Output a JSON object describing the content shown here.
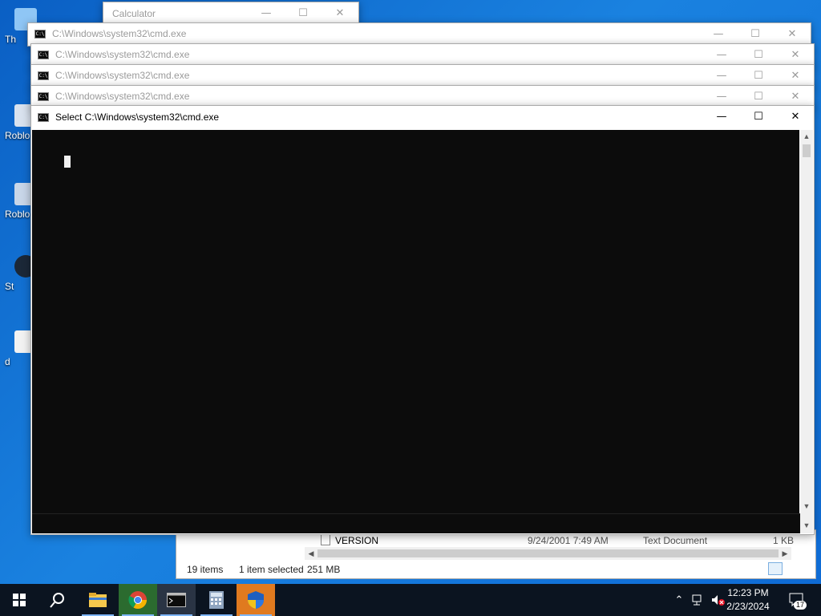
{
  "desktop": {
    "icons": [
      {
        "label": "Th",
        "name": "this-pc"
      },
      {
        "label": "Roblo",
        "name": "roblox-player"
      },
      {
        "label": "Roblo",
        "name": "roblox-studio"
      },
      {
        "label": "St",
        "name": "steam"
      },
      {
        "label": "d",
        "name": "document"
      }
    ]
  },
  "calculator": {
    "title": "Calculator"
  },
  "cmd_windows": [
    {
      "title": "C:\\Windows\\system32\\cmd.exe"
    },
    {
      "title": "C:\\Windows\\system32\\cmd.exe"
    },
    {
      "title": "C:\\Windows\\system32\\cmd.exe"
    },
    {
      "title": "C:\\Windows\\system32\\cmd.exe"
    }
  ],
  "active_cmd": {
    "title": "Select C:\\Windows\\system32\\cmd.exe"
  },
  "window_controls": {
    "minimize": "—",
    "maximize": "☐",
    "close": "✕"
  },
  "explorer": {
    "row": {
      "name": "VERSION",
      "date": "9/24/2001 7:49 AM",
      "type": "Text Document",
      "size": "1 KB"
    },
    "status": {
      "items": "19 items",
      "selected": "1 item selected",
      "size": "251 MB"
    }
  },
  "taskbar": {
    "clock_time": "12:23 PM",
    "clock_date": "2/23/2024",
    "notification_count": "17"
  },
  "colors": {
    "console_bg": "#0c0c0c",
    "taskbar_bg": "#0b1420",
    "desktop_bg": "#0e6ad4"
  }
}
